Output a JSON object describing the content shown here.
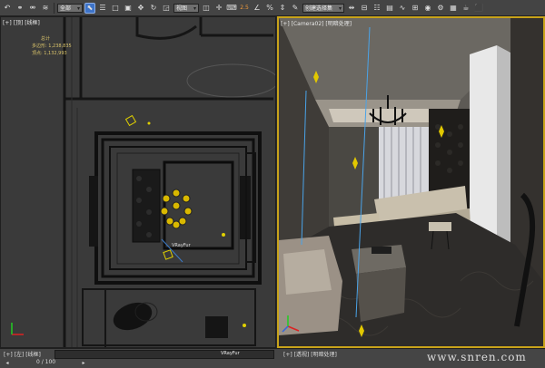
{
  "toolbar": {
    "selection_filter": "全部",
    "ref_coord": "视图",
    "named_selection": "创建选择集",
    "snaps": [
      "2.5",
      "4"
    ]
  },
  "viewport_top": {
    "label": "[+] [顶] [线框]",
    "stats_title": "总计",
    "stats_polys_label": "多边形:",
    "stats_polys_value": "1,238,835",
    "stats_verts_label": "顶点:",
    "stats_verts_value": "1,132,993",
    "object_label": "VRayFur"
  },
  "viewport_persp": {
    "label": "[+] [Camera02] [明暗处理]"
  },
  "bottom_left_tab": "[+] [左] [线框]",
  "bottom_left_obj": "VRayFur",
  "bottom_right_tab": "[+] [透视] [明暗处理]",
  "frame_counter": "0 / 100",
  "watermark": "www.snren.com",
  "colors": {
    "active_border": "#c8a31a",
    "stats_text": "#d9c36a",
    "selected_tool": "#3d73c8"
  }
}
